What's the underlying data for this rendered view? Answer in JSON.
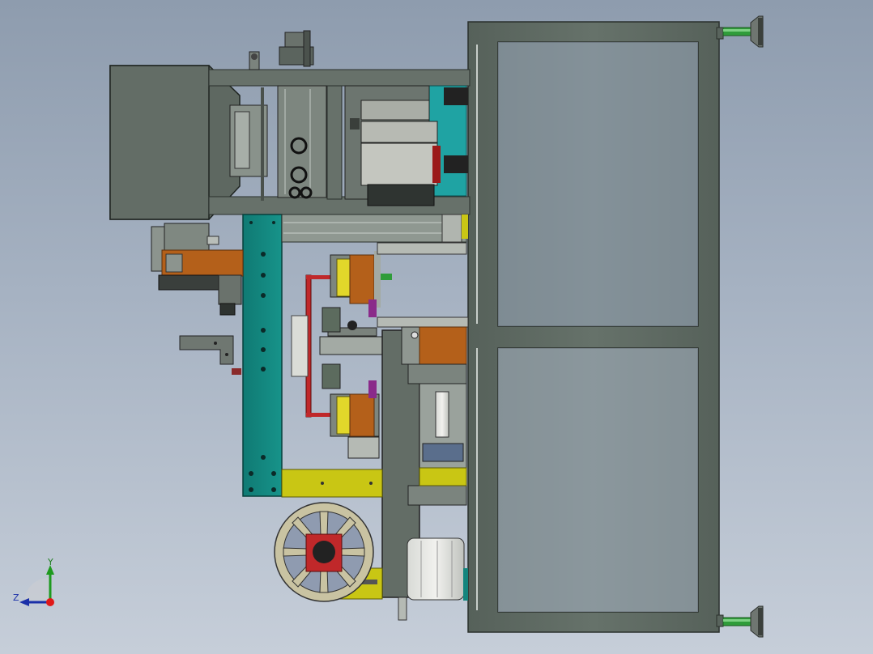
{
  "viewport": {
    "background_top": "#8e9cae",
    "background_bottom": "#c6ced9"
  },
  "colors": {
    "frame_gray": "#5f6b63",
    "frame_edge": "#2a302c",
    "teal": "#13857d",
    "cyan_accent": "#20a6a6",
    "yellow": "#c9c614",
    "orange": "#b4601a",
    "red": "#c0282a",
    "green_foot": "#2f9c3a",
    "wheel": "#c9c3a2",
    "light_gray": "#9aa29c",
    "purple": "#8a2a8a"
  },
  "triad": {
    "y_label": "Y",
    "z_label": "Z",
    "icon": "coordinate-triad-icon"
  }
}
